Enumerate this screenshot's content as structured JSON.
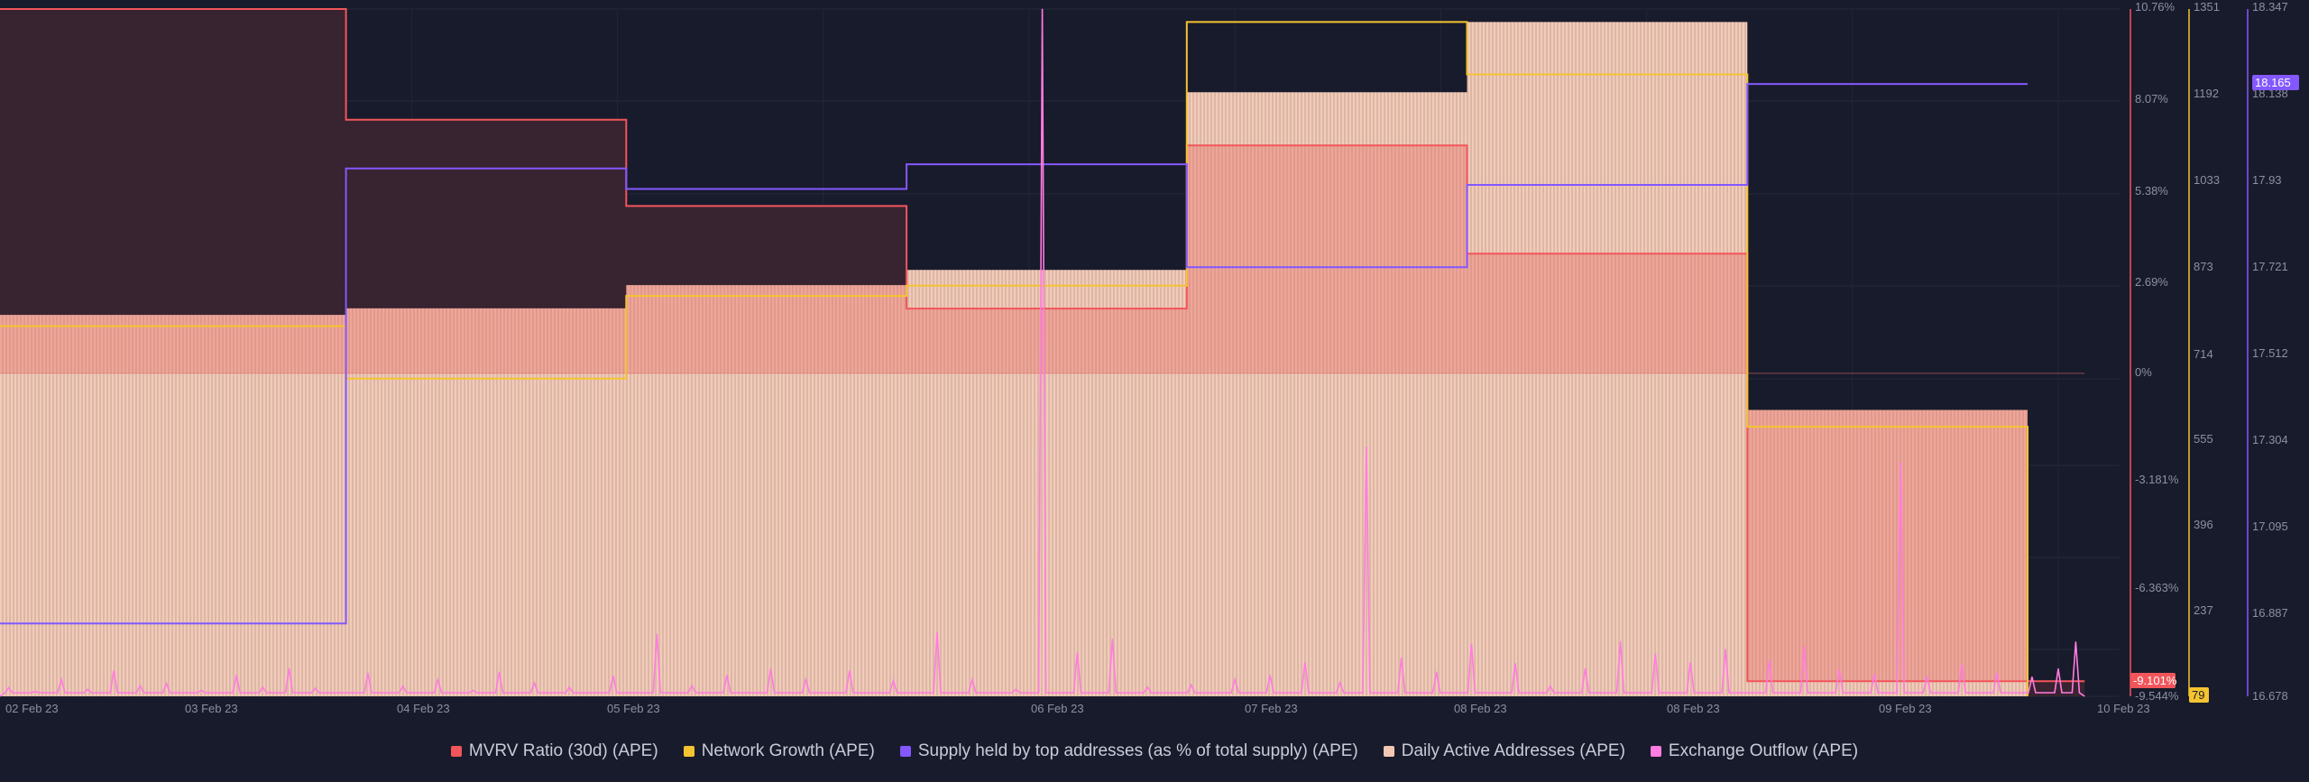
{
  "chart_data": {
    "type": "line",
    "x_categories": [
      "02 Feb 23",
      "03 Feb 23",
      "04 Feb 23",
      "05 Feb 23",
      "06 Feb 23",
      "07 Feb 23",
      "08 Feb 23",
      "08 Feb 23",
      "09 Feb 23",
      "10 Feb 23"
    ],
    "x_range": [
      "01 Feb 23 18:00",
      "10 Feb 23"
    ],
    "grid": true,
    "legend_position": "bottom",
    "axes": [
      {
        "id": "mvrv",
        "color": "#f2555a",
        "ticks": [
          "10.76%",
          "8.07%",
          "5.38%",
          "2.69%",
          "0%",
          "-3.181%",
          "-6.363%",
          "-9.544%"
        ],
        "range": [
          -9.544,
          10.76
        ],
        "current_value": "-9.101%"
      },
      {
        "id": "network",
        "color": "#f4c331",
        "ticks": [
          "1351",
          "1192",
          "1033",
          "873",
          "714",
          "555",
          "396",
          "237",
          "79"
        ],
        "range": [
          79,
          1351
        ],
        "current_value": "79"
      },
      {
        "id": "supply",
        "color": "#8358ff",
        "ticks": [
          "18.347",
          "18.138",
          "17.93",
          "17.721",
          "17.512",
          "17.304",
          "17.095",
          "16.887",
          "16.678"
        ],
        "range": [
          16.678,
          18.347
        ],
        "current_value": "18.165"
      }
    ],
    "series": [
      {
        "name": "MVRV Ratio (30d) (APE)",
        "color": "#f2555a",
        "axis": "mvrv",
        "kind": "step-area",
        "points": [
          [
            0,
            10.76
          ],
          [
            3.95,
            10.76
          ],
          [
            3.95,
            7.49
          ],
          [
            7.15,
            7.49
          ],
          [
            7.15,
            4.94
          ],
          [
            10.35,
            4.94
          ],
          [
            10.35,
            1.91
          ],
          [
            13.55,
            1.91
          ],
          [
            13.55,
            6.73
          ],
          [
            16.75,
            6.73
          ],
          [
            16.75,
            3.53
          ],
          [
            19.95,
            3.53
          ],
          [
            19.95,
            -9.1
          ],
          [
            23.8,
            -9.1
          ]
        ]
      },
      {
        "name": "Network Growth (APE)",
        "color": "#f4c331",
        "axis": "network",
        "kind": "step-line",
        "points": [
          [
            0,
            764
          ],
          [
            3.95,
            764
          ],
          [
            3.95,
            667
          ],
          [
            7.15,
            667
          ],
          [
            7.15,
            820
          ],
          [
            10.35,
            820
          ],
          [
            10.35,
            839
          ],
          [
            13.55,
            839
          ],
          [
            13.55,
            1327
          ],
          [
            16.75,
            1327
          ],
          [
            16.75,
            1230
          ],
          [
            19.95,
            1230
          ],
          [
            19.95,
            578
          ],
          [
            23.15,
            578
          ],
          [
            23.15,
            79
          ]
        ]
      },
      {
        "name": "Supply held by top addresses (as % of total supply) (APE)",
        "color": "#8358ff",
        "axis": "supply",
        "kind": "step-line",
        "points": [
          [
            0,
            16.855
          ],
          [
            3.95,
            16.855
          ],
          [
            3.95,
            17.96
          ],
          [
            7.15,
            17.96
          ],
          [
            7.15,
            17.91
          ],
          [
            10.35,
            17.91
          ],
          [
            10.35,
            17.97
          ],
          [
            13.55,
            17.97
          ],
          [
            13.55,
            17.72
          ],
          [
            16.75,
            17.72
          ],
          [
            16.75,
            17.92
          ],
          [
            19.95,
            17.92
          ],
          [
            19.95,
            18.165
          ],
          [
            23.15,
            18.165
          ]
        ]
      },
      {
        "name": "Daily Active Addresses (APE)",
        "color": "#f2c7b2",
        "axis": "network",
        "kind": "step-bars",
        "points": [
          [
            0,
            785
          ],
          [
            3.95,
            785
          ],
          [
            3.95,
            797
          ],
          [
            7.15,
            797
          ],
          [
            7.15,
            840
          ],
          [
            10.35,
            840
          ],
          [
            10.35,
            868
          ],
          [
            13.55,
            868
          ],
          [
            13.55,
            1197
          ],
          [
            16.75,
            1197
          ],
          [
            16.75,
            1327
          ],
          [
            19.95,
            1327
          ],
          [
            19.95,
            609
          ],
          [
            23.15,
            609
          ]
        ]
      },
      {
        "name": "Exchange Outflow (APE)",
        "color": "#ff7ce0",
        "axis": "network",
        "kind": "spikes",
        "points": [
          [
            0.1,
            95
          ],
          [
            0.4,
            88
          ],
          [
            0.7,
            110
          ],
          [
            1.0,
            92
          ],
          [
            1.3,
            126
          ],
          [
            1.6,
            99
          ],
          [
            1.9,
            103
          ],
          [
            2.3,
            90
          ],
          [
            2.7,
            118
          ],
          [
            3.0,
            96
          ],
          [
            3.3,
            130
          ],
          [
            3.6,
            94
          ],
          [
            4.2,
            122
          ],
          [
            4.6,
            98
          ],
          [
            5.0,
            110
          ],
          [
            5.4,
            90
          ],
          [
            5.7,
            124
          ],
          [
            6.1,
            104
          ],
          [
            6.5,
            96
          ],
          [
            7.0,
            117
          ],
          [
            7.5,
            194
          ],
          [
            7.9,
            99
          ],
          [
            8.3,
            118
          ],
          [
            8.8,
            130
          ],
          [
            9.2,
            110
          ],
          [
            9.7,
            126
          ],
          [
            10.2,
            108
          ],
          [
            10.7,
            197
          ],
          [
            11.1,
            110
          ],
          [
            11.6,
            92
          ],
          [
            11.9,
            1351
          ],
          [
            12.3,
            160
          ],
          [
            12.7,
            185
          ],
          [
            13.1,
            96
          ],
          [
            13.6,
            100
          ],
          [
            14.1,
            110
          ],
          [
            14.5,
            118
          ],
          [
            14.9,
            142
          ],
          [
            15.3,
            104
          ],
          [
            15.6,
            541
          ],
          [
            16.0,
            150
          ],
          [
            16.4,
            124
          ],
          [
            16.8,
            176
          ],
          [
            17.3,
            140
          ],
          [
            17.7,
            98
          ],
          [
            18.1,
            130
          ],
          [
            18.5,
            180
          ],
          [
            18.9,
            158
          ],
          [
            19.3,
            142
          ],
          [
            19.7,
            166
          ],
          [
            20.2,
            145
          ],
          [
            20.6,
            172
          ],
          [
            21.0,
            128
          ],
          [
            21.4,
            120
          ],
          [
            21.7,
            512
          ],
          [
            22.0,
            116
          ],
          [
            22.4,
            138
          ],
          [
            22.8,
            122
          ],
          [
            23.2,
            115
          ],
          [
            23.5,
            130
          ],
          [
            23.7,
            180
          ]
        ]
      }
    ]
  },
  "legend": [
    {
      "label": "MVRV Ratio (30d) (APE)",
      "color": "#f2555a"
    },
    {
      "label": "Network Growth (APE)",
      "color": "#f4c331"
    },
    {
      "label": "Supply held by top addresses (as % of total supply) (APE)",
      "color": "#8358ff"
    },
    {
      "label": "Daily Active Addresses (APE)",
      "color": "#f2c7b2"
    },
    {
      "label": "Exchange Outflow (APE)",
      "color": "#ff7ce0"
    }
  ]
}
